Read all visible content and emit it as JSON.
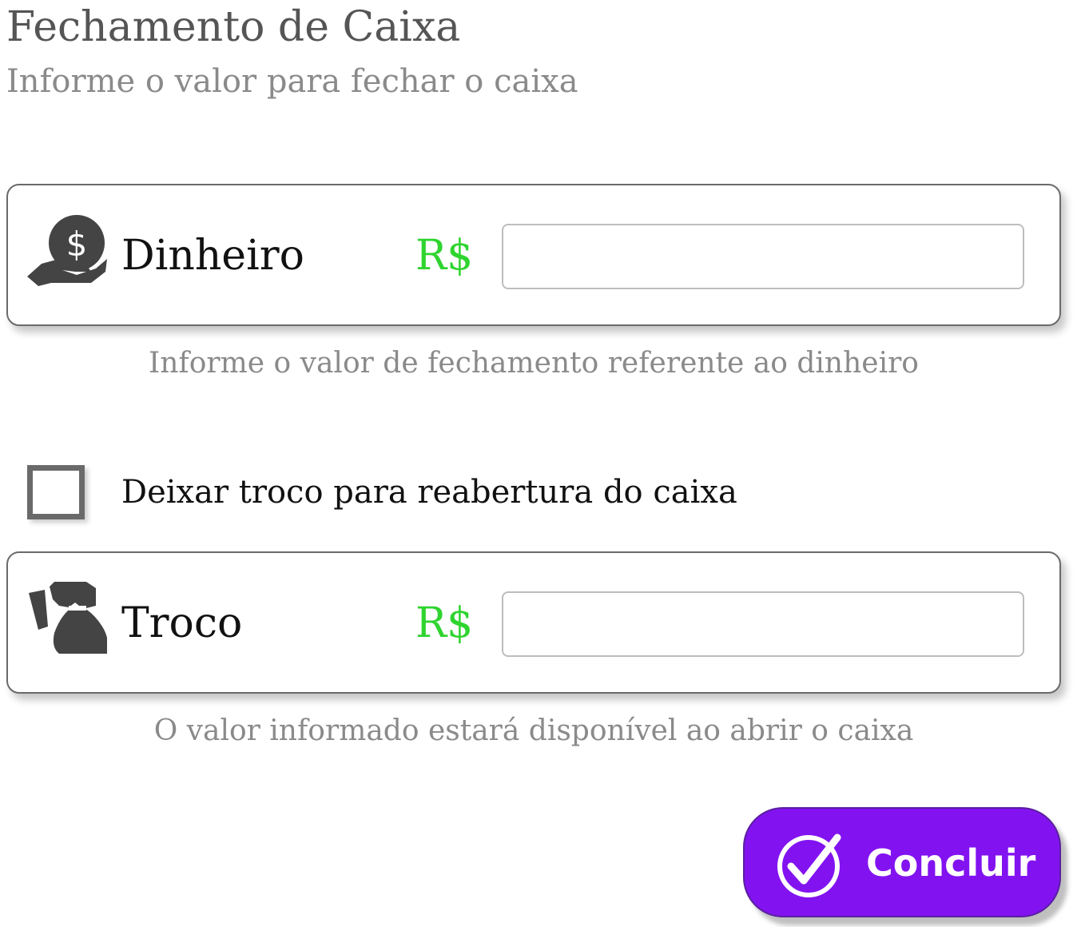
{
  "header": {
    "title": "Fechamento de Caixa",
    "subtitle": "Informe o valor para fechar o caixa"
  },
  "cash": {
    "icon": "money-hand-icon",
    "label": "Dinheiro",
    "currency": "R$",
    "value": "",
    "hint": "Informe o valor de fechamento referente ao dinheiro"
  },
  "change_option": {
    "checked": false,
    "label": "Deixar troco para reabertura do caixa"
  },
  "change": {
    "icon": "money-bag-hand-icon",
    "label": "Troco",
    "currency": "R$",
    "value": "",
    "hint": "O valor informado estará disponível ao abrir o caixa"
  },
  "actions": {
    "confirm_label": "Concluir",
    "confirm_icon": "check-circle-icon"
  },
  "colors": {
    "currency": "#2fd42f",
    "button": "#8213f0",
    "icon": "#444444"
  }
}
